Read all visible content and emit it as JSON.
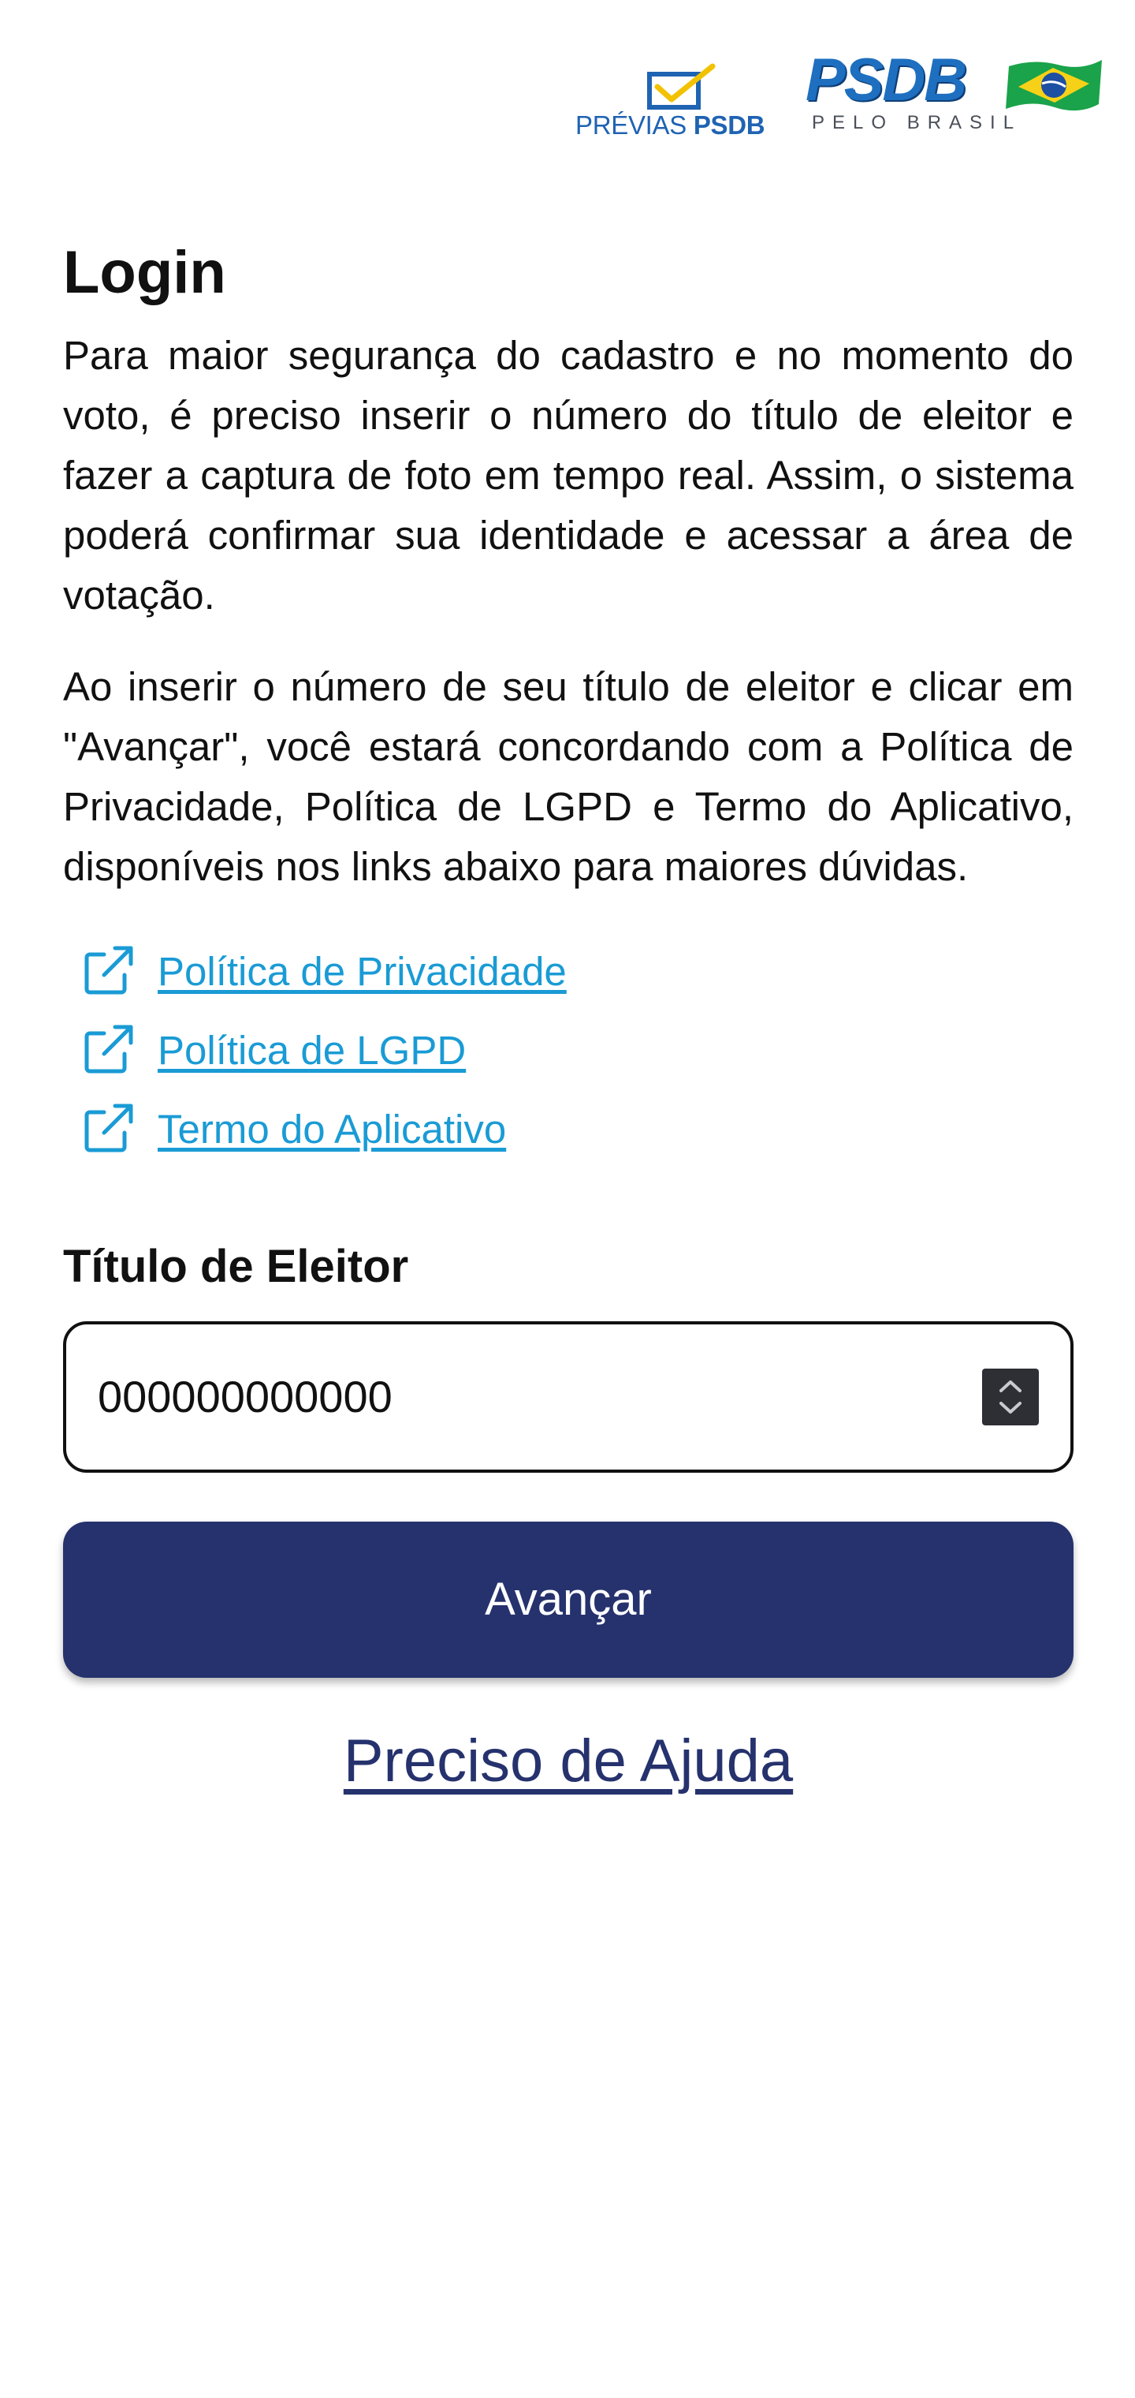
{
  "header": {
    "previas_logo": {
      "word_a": "PRÉVIAS",
      "word_b": "PSDB",
      "icon": "ballot-check-icon"
    },
    "psdb_logo": {
      "word": "PSDB",
      "tagline": "PELO BRASIL",
      "icon": "brazil-flag-icon"
    }
  },
  "login": {
    "title": "Login",
    "paragraph_1": "Para maior segurança do cadastro e no momento do voto, é preciso inserir o número do título de eleitor e fazer a captura de foto em tempo real. Assim, o sistema poderá confirmar sua identidade e acessar a área de votação.",
    "paragraph_2": "Ao inserir o número de seu título de eleitor e clicar em \"Avançar\", você estará concordando com a Política de Privacidade, Política de LGPD e Termo do Aplicativo, disponíveis nos links abaixo para maiores dúvidas.",
    "links": [
      {
        "label": "Política de Privacidade",
        "icon": "external-link-icon"
      },
      {
        "label": "Política de LGPD",
        "icon": "external-link-icon"
      },
      {
        "label": "Termo do Aplicativo",
        "icon": "external-link-icon"
      }
    ],
    "field_label": "Título de Eleitor",
    "field_value": "000000000000",
    "submit_label": "Avançar",
    "help_label": "Preciso de Ajuda"
  },
  "colors": {
    "primary": "#26326d",
    "link": "#1a9bd5",
    "logo_blue": "#1e6fc0"
  }
}
